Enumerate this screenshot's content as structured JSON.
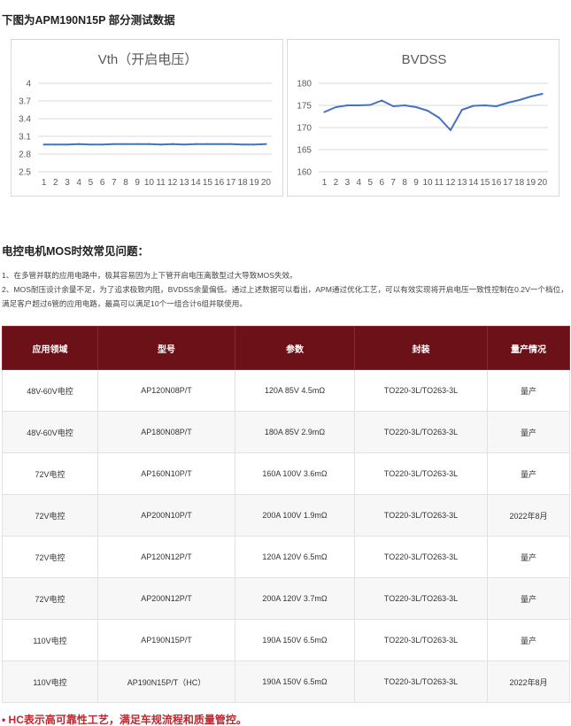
{
  "headings": {
    "test_data": "下图为APM190N15P 部分测试数据",
    "problems": "电控电机MOS时效常见问题："
  },
  "chart_data": [
    {
      "type": "line",
      "title": "Vth（开启电压）",
      "x": [
        1,
        2,
        3,
        4,
        5,
        6,
        7,
        8,
        9,
        10,
        11,
        12,
        13,
        14,
        15,
        16,
        17,
        18,
        19,
        20
      ],
      "series": [
        {
          "values": [
            2.96,
            2.96,
            2.96,
            2.97,
            2.96,
            2.96,
            2.97,
            2.97,
            2.97,
            2.97,
            2.96,
            2.97,
            2.96,
            2.97,
            2.97,
            2.97,
            2.97,
            2.96,
            2.96,
            2.97
          ]
        }
      ],
      "ylim": [
        2.5,
        4
      ],
      "yticks": [
        2.5,
        2.8,
        3.1,
        3.4,
        3.7,
        4
      ],
      "ytick_labels": [
        "2.5",
        "2.8",
        "3.1",
        "3.4",
        "3.7",
        "4"
      ],
      "grid": true,
      "color": "#4472c4"
    },
    {
      "type": "line",
      "title": "BVDSS",
      "x": [
        1,
        2,
        3,
        4,
        5,
        6,
        7,
        8,
        9,
        10,
        11,
        12,
        13,
        14,
        15,
        16,
        17,
        18,
        19,
        20
      ],
      "series": [
        {
          "values": [
            173.5,
            174.6,
            175.0,
            175.0,
            175.1,
            176.1,
            174.8,
            175.0,
            174.6,
            173.8,
            172.2,
            169.4,
            174.0,
            174.9,
            175.0,
            174.8,
            175.6,
            176.2,
            177.0,
            177.6
          ]
        }
      ],
      "ylim": [
        160,
        180
      ],
      "yticks": [
        160,
        165,
        170,
        175,
        180
      ],
      "ytick_labels": [
        "160",
        "165",
        "170",
        "175",
        "180"
      ],
      "grid": true,
      "color": "#4472c4"
    }
  ],
  "notes": [
    "1、在多管并联的应用电路中，极其容易因为上下管开启电压离散型过大导致MOS失效。",
    "2、MOS耐压设计余量不足，为了追求极致内阻，BVDSS余量偏低。通过上述数据可以看出，APM通过优化工艺，可以有效实现将开启电压一致性控制在0.2V一个档位，满足客户超过6管的应用电路，最高可以满足10个一组合计6组并联使用。"
  ],
  "table": {
    "headers": [
      "应用领域",
      "型号",
      "参数",
      "封装",
      "量产情况"
    ],
    "rows": [
      [
        "48V-60V电控",
        "AP120N08P/T",
        "120A 85V 4.5mΩ",
        "TO220-3L/TO263-3L",
        "量产"
      ],
      [
        "48V-60V电控",
        "AP180N08P/T",
        "180A 85V 2.9mΩ",
        "TO220-3L/TO263-3L",
        "量产"
      ],
      [
        "72V电控",
        "AP160N10P/T",
        "160A 100V 3.6mΩ",
        "TO220-3L/TO263-3L",
        "量产"
      ],
      [
        "72V电控",
        "AP200N10P/T",
        "200A 100V 1.9mΩ",
        "TO220-3L/TO263-3L",
        "2022年8月"
      ],
      [
        "72V电控",
        "AP120N12P/T",
        "120A 120V 6.5mΩ",
        "TO220-3L/TO263-3L",
        "量产"
      ],
      [
        "72V电控",
        "AP200N12P/T",
        "200A 120V 3.7mΩ",
        "TO220-3L/TO263-3L",
        "量产"
      ],
      [
        "110V电控",
        "AP190N15P/T",
        "190A 150V 6.5mΩ",
        "TO220-3L/TO263-3L",
        "量产"
      ],
      [
        "110V电控",
        "AP190N15P/T（HC）",
        "190A 150V 6.5mΩ",
        "TO220-3L/TO263-3L",
        "2022年8月"
      ]
    ]
  },
  "footnote": "• HC表示高可靠性工艺，满足车规流程和质量管控。"
}
